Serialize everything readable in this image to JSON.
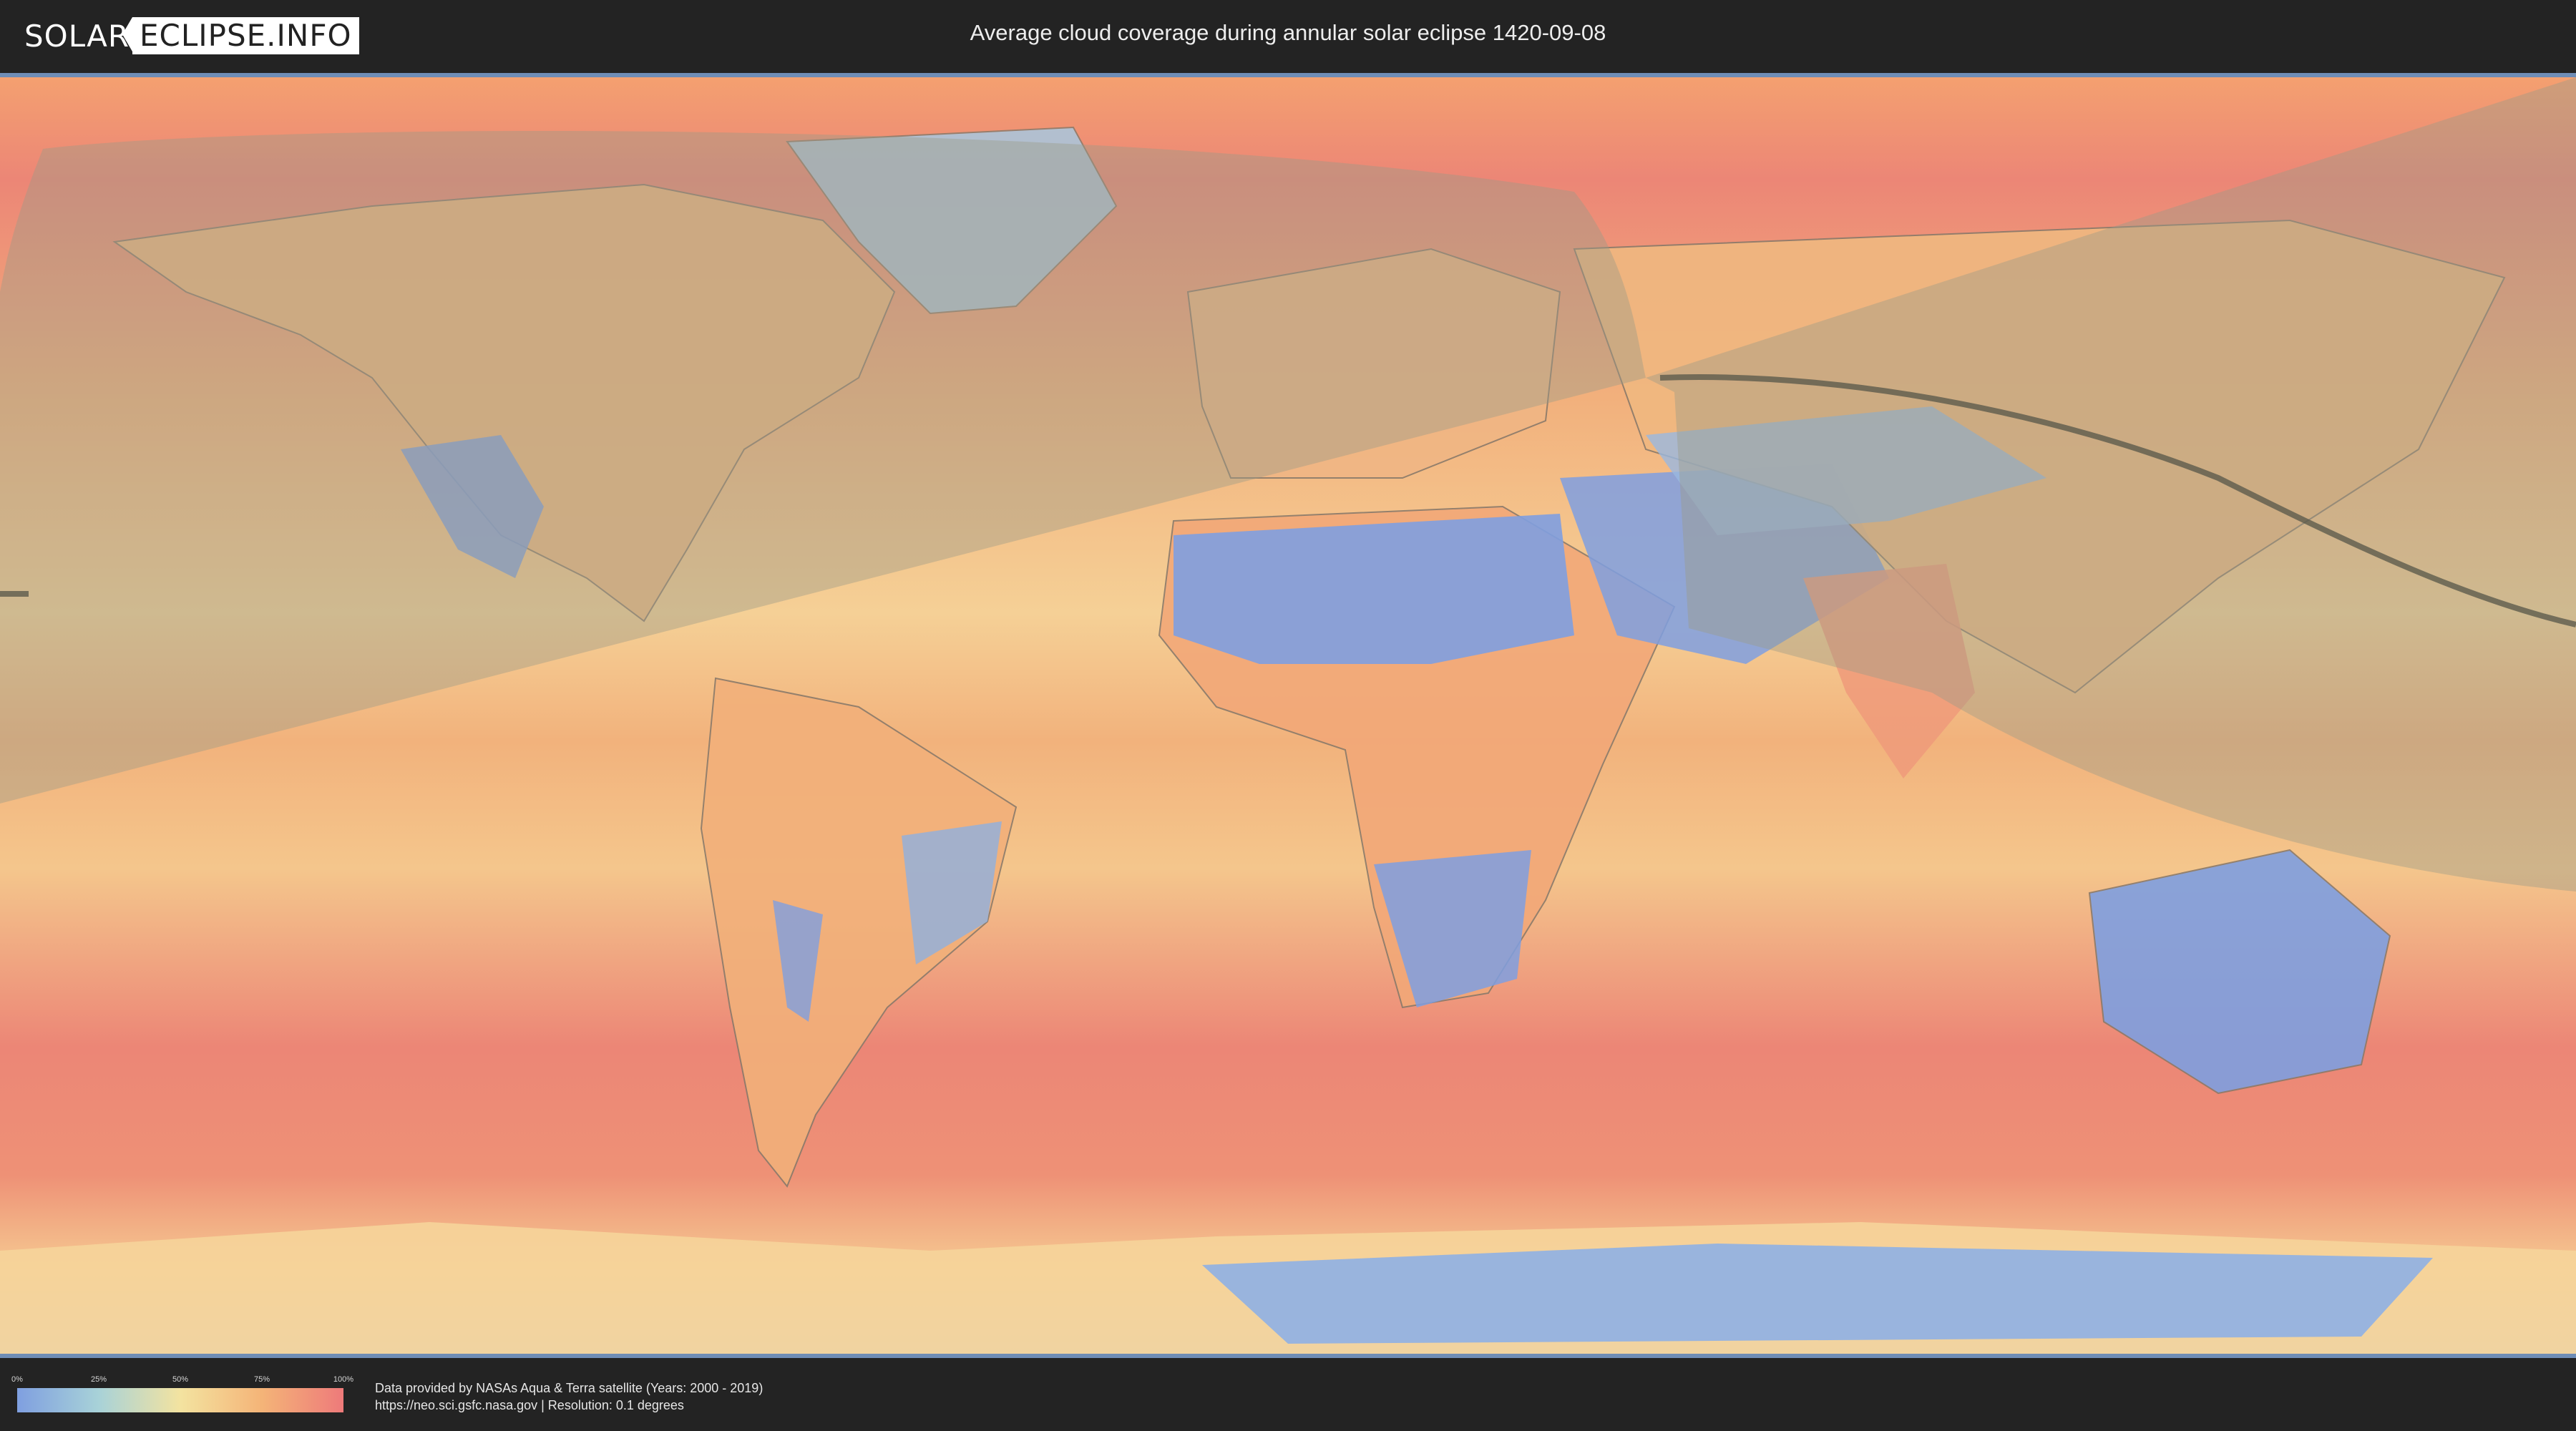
{
  "header": {
    "logo": {
      "part1": "SOLAR",
      "part2": "ECLIPSE.INFO"
    },
    "title": "Average cloud coverage during annular solar eclipse 1420-09-08"
  },
  "map": {
    "colors": {
      "clear": "#7f9fe0",
      "low": "#a8d2d8",
      "medium": "#f3e3a0",
      "high": "#f4b478",
      "overcast": "#ee7a7a",
      "eclipse_shade": "#9a9a88",
      "central_line": "#555548"
    }
  },
  "legend": {
    "ticks": [
      "0%",
      "25%",
      "50%",
      "75%",
      "100%"
    ],
    "colors": [
      "#7f9fe0",
      "#a8d2d8",
      "#f3e3a0",
      "#f4b478",
      "#ee7a7a"
    ]
  },
  "credits": {
    "line1": "Data provided by NASAs Aqua & Terra satellite (Years: 2000 - 2019)",
    "line2": "https://neo.sci.gsfc.nasa.gov | Resolution: 0.1 degrees"
  }
}
